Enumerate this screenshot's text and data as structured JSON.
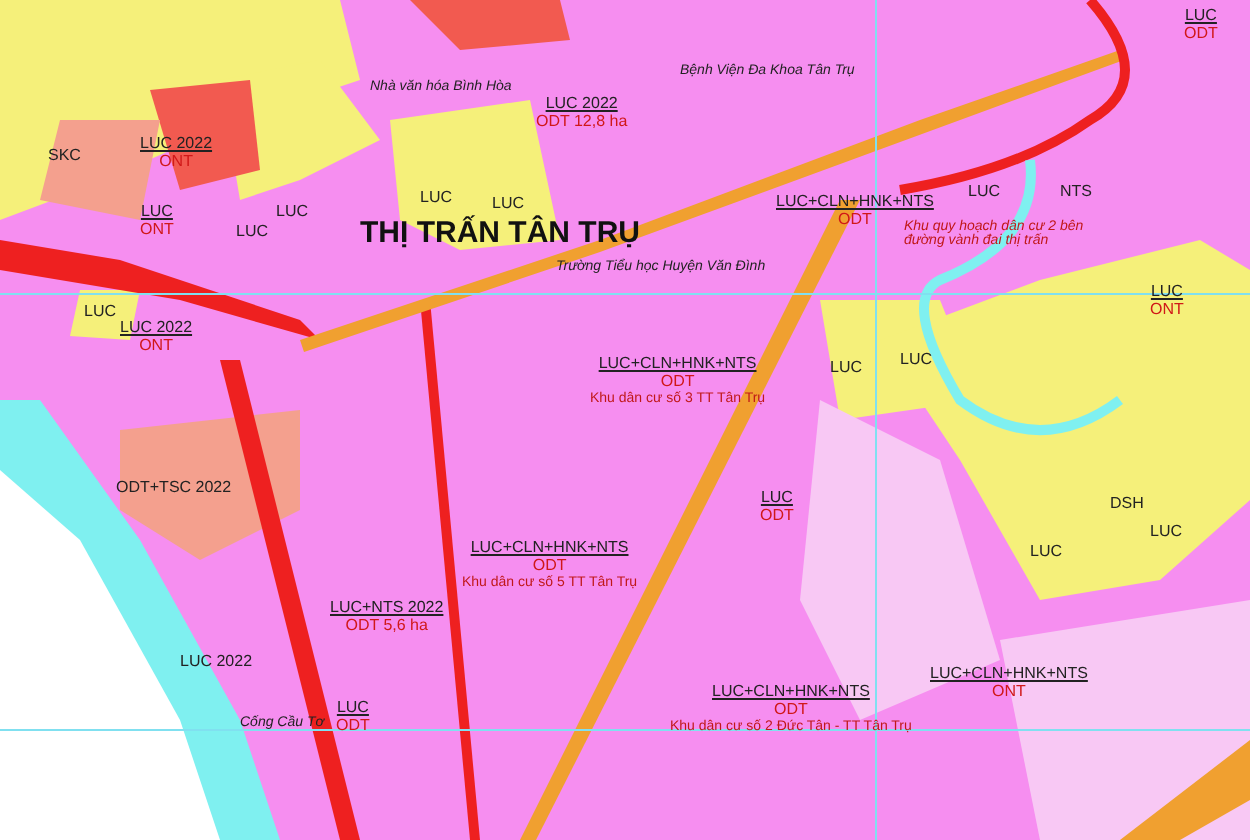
{
  "map": {
    "title": "THỊ TRẤN TÂN TRỤ",
    "zones": [
      {
        "code": "LUC 2022",
        "sub": "ONT"
      },
      {
        "code": "LUC"
      },
      {
        "code": "SKC"
      },
      {
        "code": "LUC",
        "sub": "ONT"
      },
      {
        "code": "LUC"
      },
      {
        "code": "LUC 2022",
        "sub": "ONT"
      },
      {
        "code": "LUC"
      },
      {
        "code": "LUC"
      },
      {
        "code": "LUC"
      },
      {
        "code": "LUC 2022",
        "sub": "ODT 12,8 ha"
      },
      {
        "code": "LUC",
        "sub": "ODT"
      },
      {
        "code": "LUC+CLN+HNK+NTS",
        "sub": "ODT"
      },
      {
        "code": "LUC+CLN+HNK+NTS",
        "sub": "ODT",
        "note": "Khu dân cư số 3 TT Tân Trụ"
      },
      {
        "code": "LUC"
      },
      {
        "code": "NTS"
      },
      {
        "code": "LUC"
      },
      {
        "code": "LUC"
      },
      {
        "code": "LUC",
        "sub": "ONT"
      },
      {
        "code": "ODT+TSC 2022"
      },
      {
        "code": "LUC+CLN+HNK+NTS",
        "sub": "ODT",
        "note": "Khu dân cư số 5 TT Tân Trụ"
      },
      {
        "code": "LUC+NTS 2022",
        "sub": "ODT 5,6 ha"
      },
      {
        "code": "LUC 2022"
      },
      {
        "code": "LUC",
        "sub": "ODT"
      },
      {
        "code": "LUC+CLN+HNK+NTS",
        "sub": "ODT",
        "note": "Khu dân cư số 2 Đức Tân - TT Tân Trụ"
      },
      {
        "code": "LUC+CLN+HNK+NTS",
        "sub": "ONT"
      },
      {
        "code": "LUC"
      },
      {
        "code": "DSH"
      },
      {
        "code": "LUC"
      },
      {
        "code": "LUC",
        "sub": "ODT"
      }
    ],
    "places": [
      "Bệnh Viện Đa Khoa Tân Trụ",
      "Trường Tiểu học Huyện Văn Đình",
      "Cống Cầu Tơ",
      "Nhà văn hóa Bình Hòa",
      "Khu quy hoạch dân cư 2 bên đường vành đai thị trấn"
    ]
  }
}
